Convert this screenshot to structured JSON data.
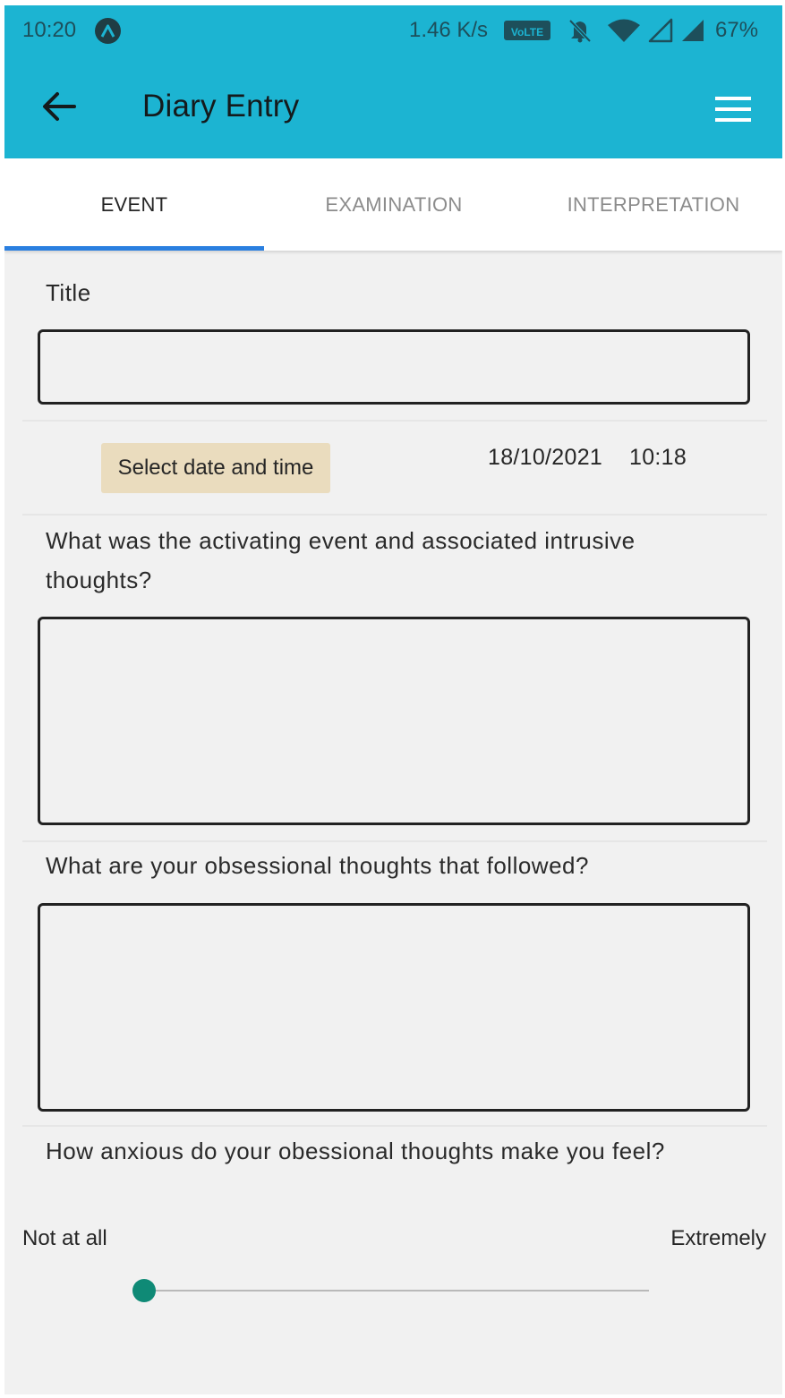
{
  "status_bar": {
    "time": "10:20",
    "network_speed": "1.46 K/s",
    "volte_badge": "VoLTE",
    "battery": "67%",
    "icons": [
      "app-notification-icon",
      "silent-bell-icon",
      "wifi-icon",
      "signal-empty-icon",
      "signal-full-icon"
    ]
  },
  "app_bar": {
    "title": "Diary Entry",
    "back_icon": "arrow-left-icon",
    "menu_icon": "hamburger-menu-icon",
    "color": "#1cb4d2"
  },
  "tabs": [
    {
      "label": "EVENT",
      "active": true
    },
    {
      "label": "EXAMINATION",
      "active": false
    },
    {
      "label": "INTERPRETATION",
      "active": false
    }
  ],
  "tab_indicator_color": "#2a7fe0",
  "form": {
    "title_label": "Title",
    "title_value": "",
    "date_button_label": "Select date and time",
    "date_value": "18/10/2021",
    "time_value": "10:18",
    "activating_event_label": "What was the activating event and associated intrusive thoughts?",
    "activating_event_value": "",
    "obsessional_thoughts_label": "What are your obsessional thoughts that followed?",
    "obsessional_thoughts_value": "",
    "anxiety_label": "How anxious do your obessional thoughts make you feel?",
    "anxiety_min_label": "Not at all",
    "anxiety_max_label": "Extremely",
    "anxiety_level": 0,
    "slider_color": "#0f8a76"
  }
}
